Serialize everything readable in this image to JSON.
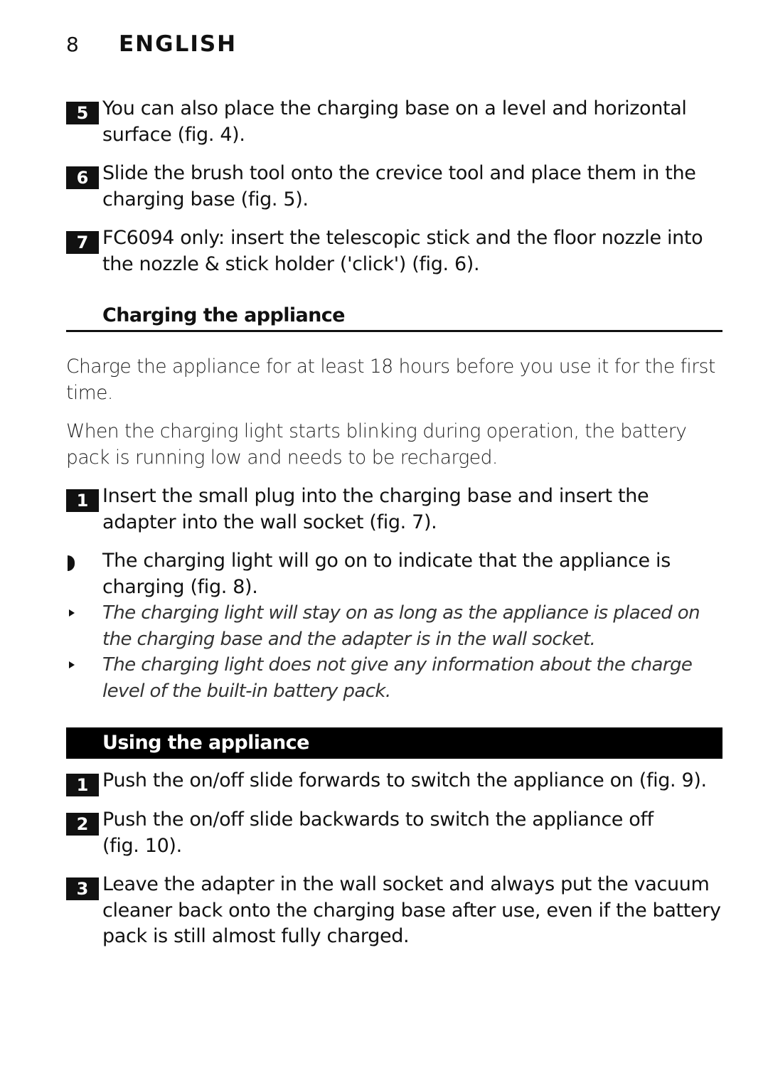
{
  "header": {
    "page_number": "8",
    "language": "ENGLISH"
  },
  "steps_top": [
    {
      "num": "5",
      "text": "You can also place the charging base on a level and horizontal surface (fig. 4)."
    },
    {
      "num": "6",
      "text": "Slide the brush tool onto the crevice tool and place them in the charging base (fig. 5)."
    },
    {
      "num": "7",
      "text": "FC6094 only: insert the telescopic stick and the floor nozzle into the nozzle & stick holder ('click') (fig. 6)."
    }
  ],
  "charging": {
    "heading": "Charging the appliance",
    "para1": "Charge the appliance for at least 18 hours before you use it for the first time.",
    "para2": "When the charging light starts blinking during operation, the battery pack is running low and needs to be recharged.",
    "step1": {
      "num": "1",
      "text": "Insert the small plug into the charging base and insert the adapter into the wall socket (fig. 7)."
    },
    "result": "The charging light will go on to indicate that the appliance is charging (fig. 8).",
    "notes": [
      "The charging light will stay on as long as the appliance is placed on the charging base and the adapter is in the wall socket.",
      "The charging light does not give any information about the charge level of the built-in battery pack."
    ]
  },
  "using": {
    "heading": "Using the appliance",
    "steps": [
      {
        "num": "1",
        "text": "Push the on/off slide forwards to switch the appliance on (fig. 9)."
      },
      {
        "num": "2",
        "text": "Push the on/off slide backwards to switch the appliance off (fig. 10)."
      },
      {
        "num": "3",
        "text": "Leave the adapter in the wall socket and always put the vacuum cleaner back onto the charging base after use, even if the battery pack is still almost fully charged."
      }
    ]
  }
}
